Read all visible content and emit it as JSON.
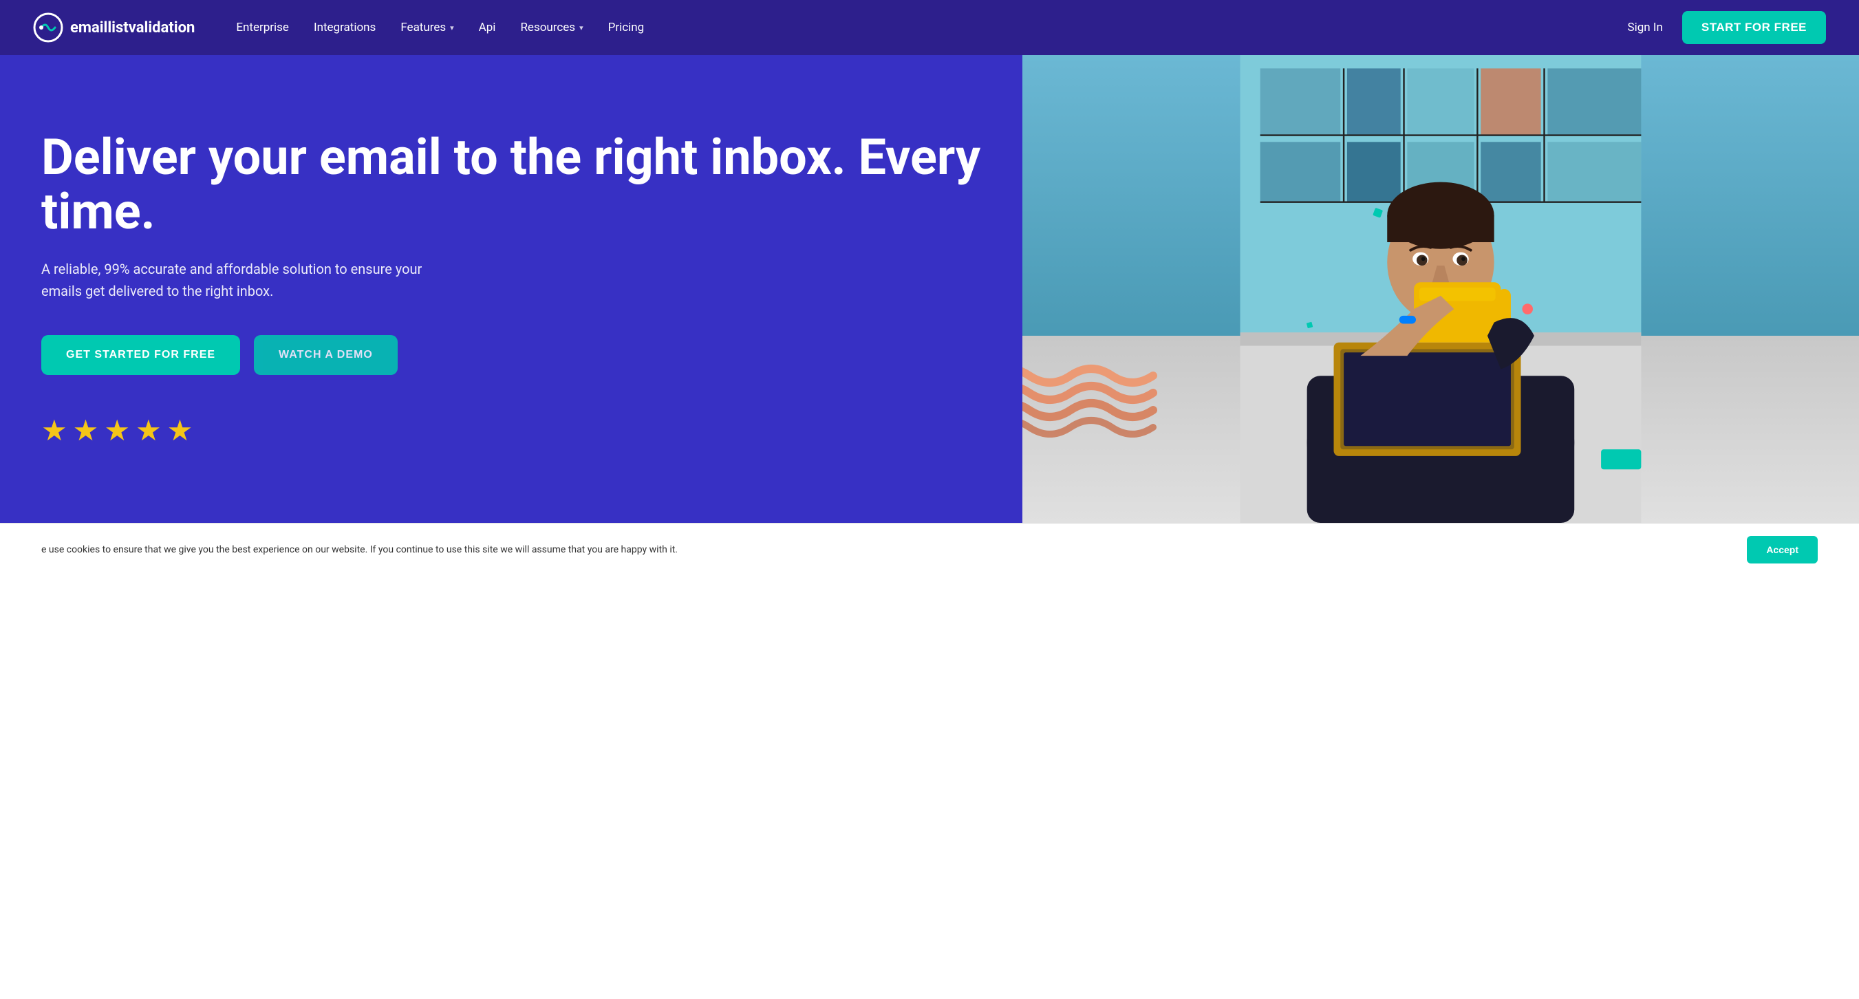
{
  "brand": {
    "name_part1": "emaillist",
    "name_part2": "validation",
    "logo_alt": "emaillistvalidation logo"
  },
  "nav": {
    "links": [
      {
        "label": "Enterprise",
        "has_dropdown": false
      },
      {
        "label": "Integrations",
        "has_dropdown": false
      },
      {
        "label": "Features",
        "has_dropdown": true
      },
      {
        "label": "Api",
        "has_dropdown": false
      },
      {
        "label": "Resources",
        "has_dropdown": true
      },
      {
        "label": "Pricing",
        "has_dropdown": false
      }
    ],
    "sign_in": "Sign In",
    "start_free": "START FOR FREE"
  },
  "hero": {
    "title": "Deliver your email to the right inbox. Every time.",
    "subtitle": "A reliable, 99% accurate and affordable solution to ensure your emails get delivered to the right inbox.",
    "btn_primary": "GET STARTED FOR FREE",
    "btn_secondary": "WATCH A DEMO",
    "stars_count": 5
  },
  "cookie": {
    "text": "e use cookies to ensure that we give you the best experience on our website. If you continue to use this site we will assume that you are happy with it.",
    "accept_label": "Accept"
  },
  "colors": {
    "nav_bg": "#2d1f8c",
    "hero_bg": "#3730c4",
    "accent": "#00c9b1",
    "star": "#f5c518"
  }
}
